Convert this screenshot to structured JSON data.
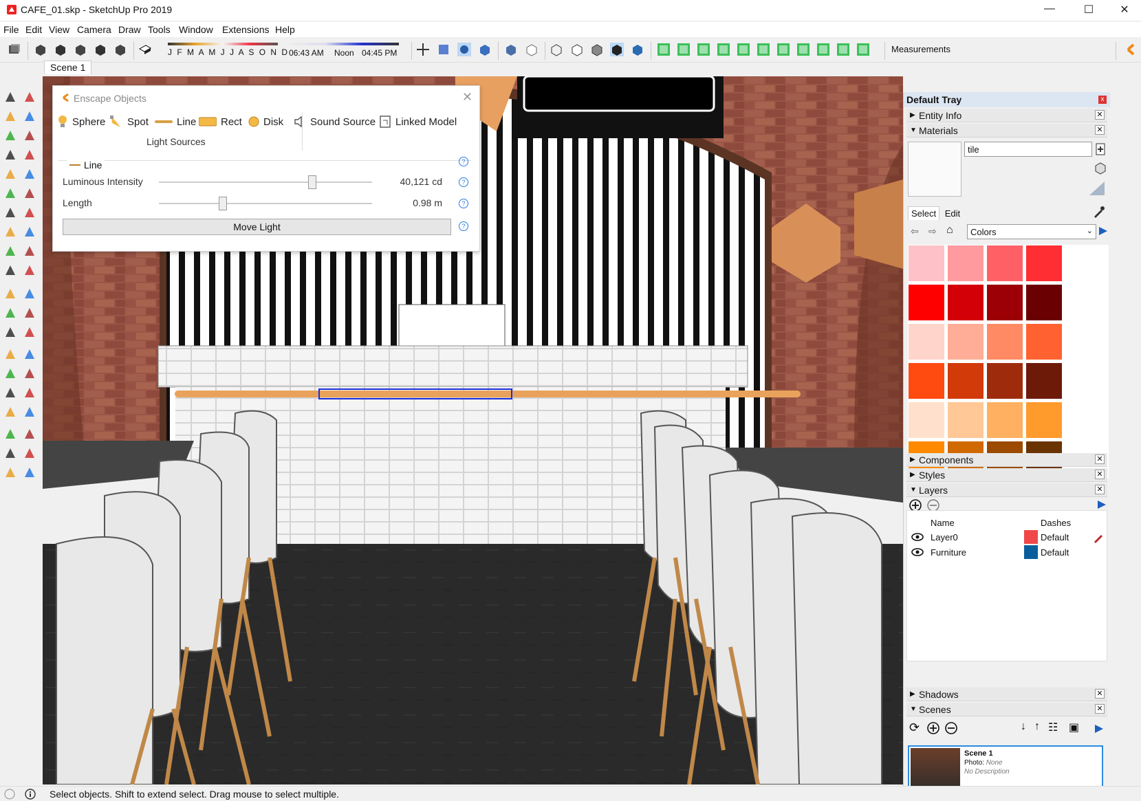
{
  "window": {
    "title": "CAFE_01.skp - SketchUp Pro 2019",
    "minimize": "—",
    "maximize": "☐",
    "close": "✕"
  },
  "menu": [
    "File",
    "Edit",
    "View",
    "Camera",
    "Draw",
    "Tools",
    "Window",
    "Extensions",
    "Help"
  ],
  "toolbar": {
    "months": "J F M A M J J A S O N D",
    "time_start": "06:43 AM",
    "time_mid": "Noon",
    "time_end": "04:45 PM",
    "measurements_label": "Measurements"
  },
  "scene_tab": "Scene 1",
  "enscape": {
    "title": "Enscape Objects",
    "objects": [
      "Sphere",
      "Spot",
      "Line",
      "Rect",
      "Disk",
      "Sound Source",
      "Linked Model"
    ],
    "light_sources_label": "Light Sources",
    "group_title": "Line",
    "rows": [
      {
        "label": "Luminous Intensity",
        "value": "40,121 cd",
        "fraction": 0.72
      },
      {
        "label": "Length",
        "value": "0.98 m",
        "fraction": 0.3
      }
    ],
    "move_light": "Move Light",
    "help": "?"
  },
  "tray": {
    "title": "Default Tray",
    "close": "x",
    "panels": [
      "Entity Info",
      "Materials",
      "Components",
      "Styles",
      "Layers",
      "Shadows",
      "Scenes"
    ],
    "materials": {
      "name": "tile",
      "tab_select": "Select",
      "tab_edit": "Edit",
      "library": "Colors",
      "swatch_colors": [
        "#ffc1c8",
        "#ff9a9e",
        "#ff6066",
        "#ff2e33",
        "#ff0000",
        "#d40007",
        "#9c0006",
        "#6a0002",
        "#ffd4ca",
        "#ffad96",
        "#ff8a63",
        "#ff6230",
        "#ff4a10",
        "#d23a0a",
        "#9e2c0c",
        "#6e1a09",
        "#ffe0cc",
        "#ffc896",
        "#ffb060",
        "#ff9a2c",
        "#ff8a00",
        "#d06a00",
        "#9c4a00",
        "#6a3300"
      ]
    },
    "layers": {
      "col_name": "Name",
      "col_dashes": "Dashes",
      "rows": [
        {
          "name": "Layer0",
          "color": "#f04848",
          "dash": "Default"
        },
        {
          "name": "Furniture",
          "color": "#0a5e9c",
          "dash": "Default"
        }
      ]
    },
    "scenes": {
      "card_name": "Scene 1",
      "photo_label": "Photo:",
      "photo_value": "None",
      "description": "No Description"
    }
  },
  "status": {
    "text": "Select objects. Shift to extend select. Drag mouse to select multiple."
  }
}
